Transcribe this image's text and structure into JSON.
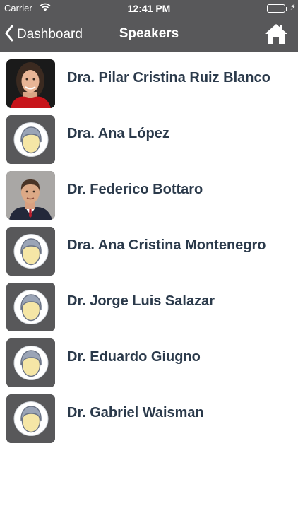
{
  "status_bar": {
    "carrier": "Carrier",
    "time": "12:41 PM",
    "battery_level": 1.0,
    "battery_color": "#4cd964"
  },
  "nav": {
    "back_label": "Dashboard",
    "title": "Speakers",
    "back_icon": "chevron-left-icon",
    "home_icon": "home-icon"
  },
  "colors": {
    "bar_bg": "#58585a",
    "name_text": "#2b3a4b",
    "placeholder_face": "#f5e6a6",
    "placeholder_hair": "#9aa4b6"
  },
  "speakers": [
    {
      "name": "Dra. Pilar Cristina Ruiz Blanco",
      "avatar": "photo-woman"
    },
    {
      "name": "Dra. Ana López",
      "avatar": "placeholder"
    },
    {
      "name": "Dr. Federico Bottaro",
      "avatar": "photo-man"
    },
    {
      "name": "Dra. Ana Cristina Montenegro",
      "avatar": "placeholder"
    },
    {
      "name": "Dr. Jorge Luis Salazar",
      "avatar": "placeholder"
    },
    {
      "name": "Dr. Eduardo Giugno",
      "avatar": "placeholder"
    },
    {
      "name": "Dr. Gabriel Waisman",
      "avatar": "placeholder"
    }
  ]
}
